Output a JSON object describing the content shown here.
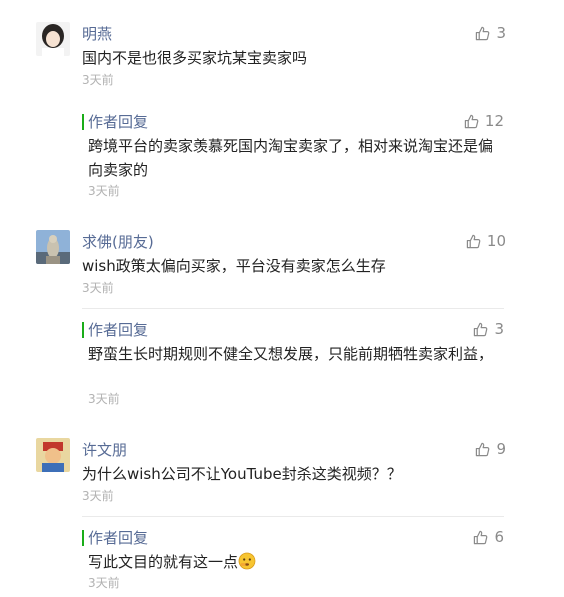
{
  "comments": [
    {
      "author": "明燕",
      "text": "国内不是也很多买家坑某宝卖家吗",
      "time": "3天前",
      "likes": "3",
      "reply": {
        "label": "作者回复",
        "text": "跨境平台的卖家羡慕死国内淘宝卖家了，相对来说淘宝还是偏向卖家的",
        "time": "3天前",
        "likes": "12"
      }
    },
    {
      "author": "求佛(朋友)",
      "text": "wish政策太偏向买家，平台没有卖家怎么生存",
      "time": "3天前",
      "likes": "10",
      "reply": {
        "label": "作者回复",
        "text": "野蛮生长时期规则不健全又想发展，只能前期牺牲卖家利益，",
        "time": "3天前",
        "likes": "3"
      }
    },
    {
      "author": "许文朋",
      "text": "为什么wish公司不让YouTube封杀这类视频？？",
      "time": "3天前",
      "likes": "9",
      "reply": {
        "label": "作者回复",
        "text": "写此文目的就有这一点",
        "time": "3天前",
        "likes": "6"
      }
    }
  ],
  "icons": {
    "like": "thumbs-up-icon",
    "emoji": "thinking-face-emoji"
  },
  "colors": {
    "name": "#576b95",
    "reply_bar": "#1aad19",
    "muted": "#b2b2b2"
  }
}
